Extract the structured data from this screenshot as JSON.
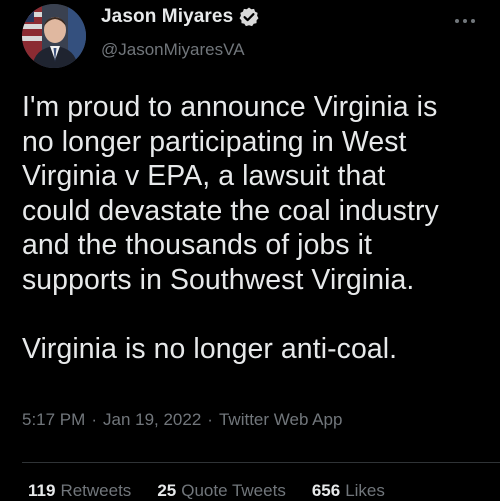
{
  "author": {
    "display_name": "Jason Miyares",
    "handle": "@JasonMiyaresVA",
    "verified_icon": "verified-badge-icon",
    "avatar_icon": "avatar"
  },
  "tweet": {
    "text": "I'm proud to announce Virginia is\nno longer participating in West\nVirginia v EPA, a lawsuit that\ncould devastate the coal industry\nand the thousands of jobs it\nsupports in Southwest Virginia.\n\nVirginia is no longer anti-coal."
  },
  "meta": {
    "time": "5:17 PM",
    "separator": "·",
    "date": "Jan 19, 2022",
    "source": "Twitter Web App"
  },
  "stats": {
    "retweets_count": "119",
    "retweets_label": "Retweets",
    "quotes_count": "25",
    "quotes_label": "Quote Tweets",
    "likes_count": "656",
    "likes_label": "Likes"
  },
  "colors": {
    "background": "#000000",
    "primary_text": "#e7e9ea",
    "secondary_text": "#71767b",
    "verified": "#d9d9d9",
    "divider": "#2f3336"
  }
}
